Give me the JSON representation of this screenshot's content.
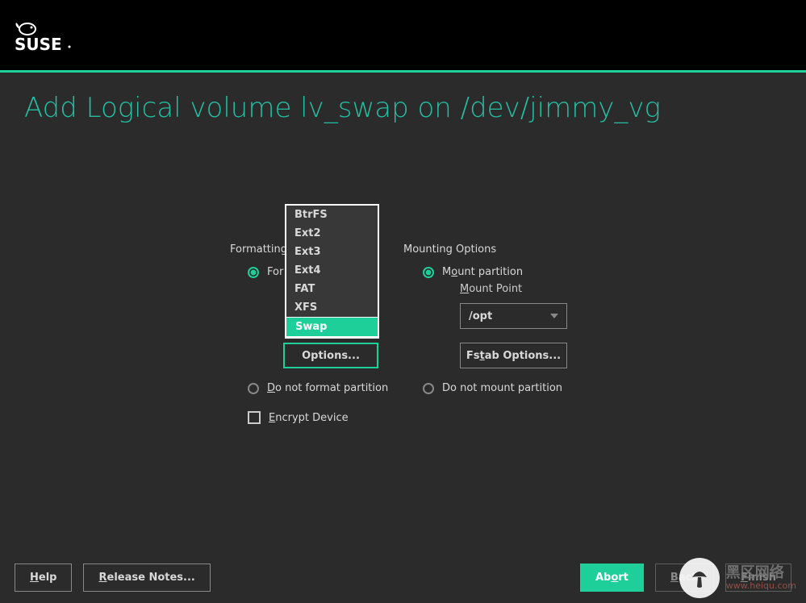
{
  "header": {
    "brand": "SUSE"
  },
  "title": "Add Logical volume lv_swap on /dev/jimmy_vg",
  "formatting": {
    "section_label": "Formatting",
    "format_label_prefix": "For",
    "options_label": "Options...",
    "no_format_label": "o not format partition",
    "no_format_accel": "D",
    "encrypt_label": "ncrypt Device",
    "encrypt_accel": "E"
  },
  "mounting": {
    "section_label": "Mounting Options",
    "mount_label_prefix": "M",
    "mount_label_rest": "unt partition",
    "mount_accel": "o",
    "mount_point_accel": "M",
    "mount_point_rest": "ount Point",
    "mount_point_value": "/opt",
    "fstab_label_prefix": "Fs",
    "fstab_accel": "t",
    "fstab_label_rest": "ab Options...",
    "no_mount_label": "Do not mount partition"
  },
  "fs_options": [
    "BtrFS",
    "Ext2",
    "Ext3",
    "Ext4",
    "FAT",
    "XFS",
    "Swap"
  ],
  "fs_selected": "Swap",
  "footer": {
    "help": "elp",
    "help_accel": "H",
    "release": "elease Notes...",
    "release_accel": "R",
    "abort": "rt",
    "abort_accel": "o",
    "abort_prefix": "Ab",
    "back": "ack",
    "back_accel": "B",
    "finish": "inish",
    "finish_accel": "F"
  },
  "watermark": {
    "line1": "黑区网络",
    "line2": "www.heiqu.com"
  }
}
